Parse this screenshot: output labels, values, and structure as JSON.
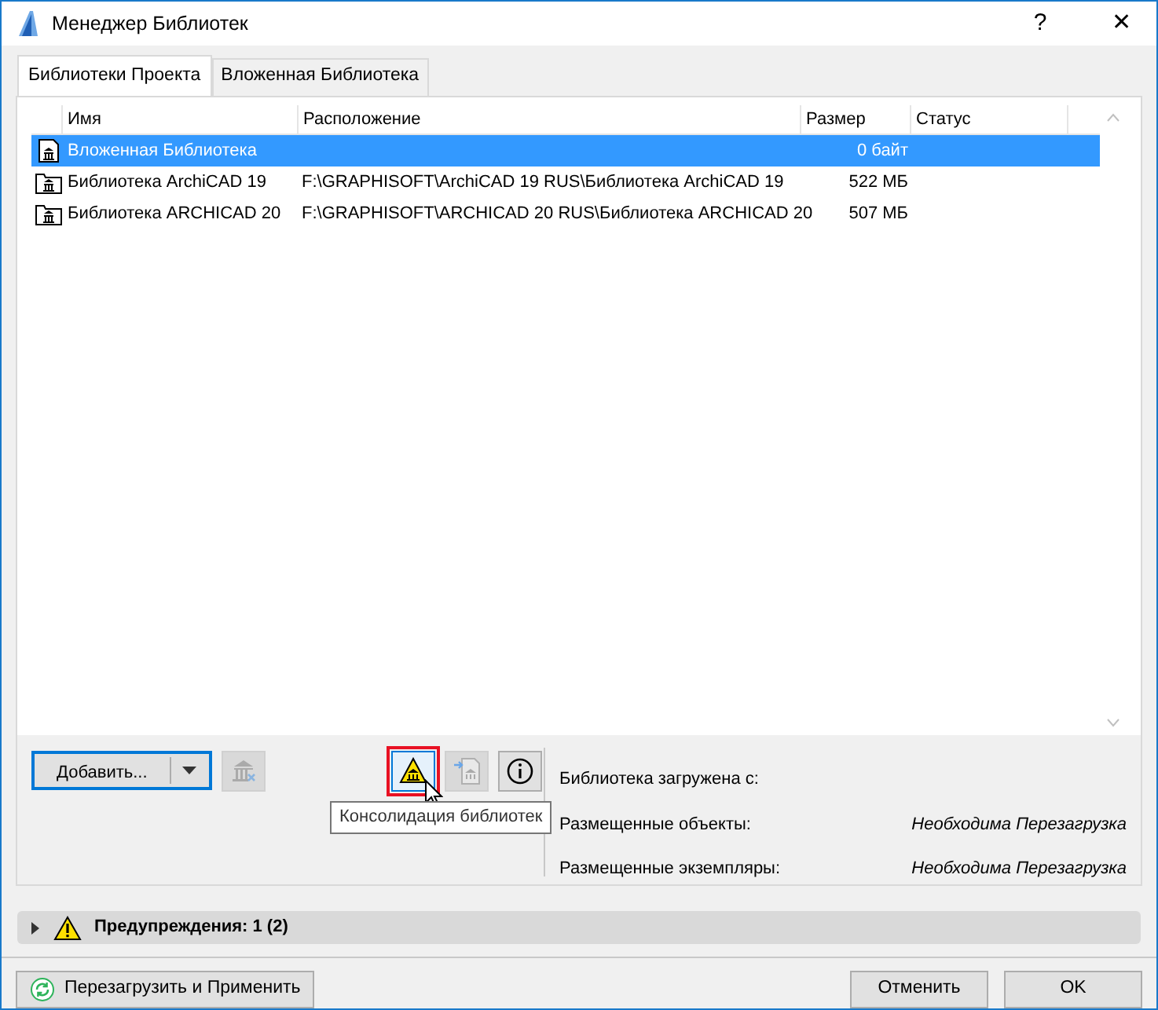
{
  "window": {
    "title": "Менеджер Библиотек",
    "help": "?",
    "close": "✕"
  },
  "tabs": [
    {
      "label": "Библиотеки Проекта",
      "selected": true
    },
    {
      "label": "Вложенная Библиотека",
      "selected": false
    }
  ],
  "table": {
    "columns": [
      "Имя",
      "Расположение",
      "Размер",
      "Статус"
    ],
    "rows": [
      {
        "kind": "embedded",
        "name": "Вложенная Библиотека",
        "location": "",
        "size": "0 байт",
        "status": "",
        "selected": true
      },
      {
        "kind": "folder",
        "name": "Библиотека ArchiCAD 19",
        "location": "F:\\GRAPHISOFT\\ArchiCAD 19 RUS\\Библиотека ArchiCAD 19",
        "size": "522 МБ",
        "status": "",
        "selected": false
      },
      {
        "kind": "folder",
        "name": "Библиотека ARCHICAD 20",
        "location": "F:\\GRAPHISOFT\\ARCHICAD 20 RUS\\Библиотека ARCHICAD 20",
        "size": "507 МБ",
        "status": "",
        "selected": false
      }
    ]
  },
  "toolbar": {
    "add_button": "Добавить...",
    "tools": [
      {
        "kind": "remove",
        "disabled": true,
        "highlighted": false
      },
      {
        "kind": "consolidate",
        "disabled": false,
        "highlighted": true
      },
      {
        "kind": "export",
        "disabled": true,
        "highlighted": false
      },
      {
        "kind": "info",
        "disabled": false,
        "highlighted": false
      }
    ],
    "tooltip": "Консолидация библиотек"
  },
  "info": {
    "loaded_from": "Библиотека загружена с:",
    "fields": [
      {
        "label": "Размещенные объекты:",
        "value": "Необходима Перезагрузка"
      },
      {
        "label": "Размещенные экземпляры:",
        "value": "Необходима Перезагрузка"
      }
    ]
  },
  "warnings": {
    "label": "Предупреждения: 1 (2)",
    "expanded": false
  },
  "buttons": {
    "reload": "Перезагрузить и Применить",
    "cancel": "Отменить",
    "ok": "OK"
  }
}
